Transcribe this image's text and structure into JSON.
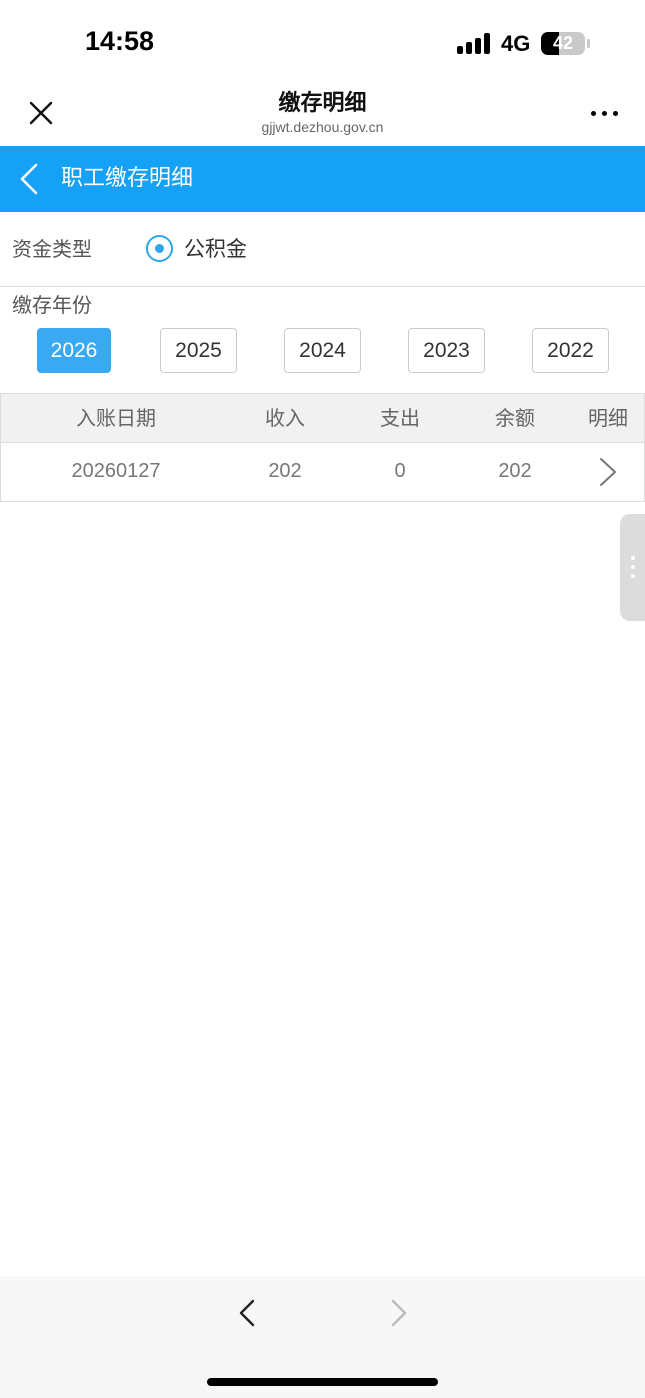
{
  "status_bar": {
    "time": "14:58",
    "network": "4G",
    "battery": "42",
    "battery_level": 0.42
  },
  "browser": {
    "title": "缴存明细",
    "url": "gjjwt.dezhou.gov.cn",
    "close_icon": "close-icon",
    "more_icon": "more-icon"
  },
  "header": {
    "title": "职工缴存明细",
    "back_icon": "chevron-left-icon",
    "background": "#15a1f5"
  },
  "fund_type": {
    "label": "资金类型",
    "option": "公积金",
    "selected": true
  },
  "year": {
    "label": "缴存年份",
    "options": [
      "2026",
      "2025",
      "2024",
      "2023",
      "2022"
    ],
    "selected": "2026",
    "active_color": "#3ba9f2"
  },
  "table": {
    "headers": [
      "入账日期",
      "收入",
      "支出",
      "余额",
      "明细"
    ],
    "rows": [
      {
        "date": "20260127",
        "income": "202",
        "expense": "0",
        "balance": "202",
        "detail_icon": "chevron-right-icon"
      }
    ]
  },
  "bottom_nav": {
    "back_icon": "chevron-left-icon",
    "forward_icon": "chevron-right-icon"
  }
}
